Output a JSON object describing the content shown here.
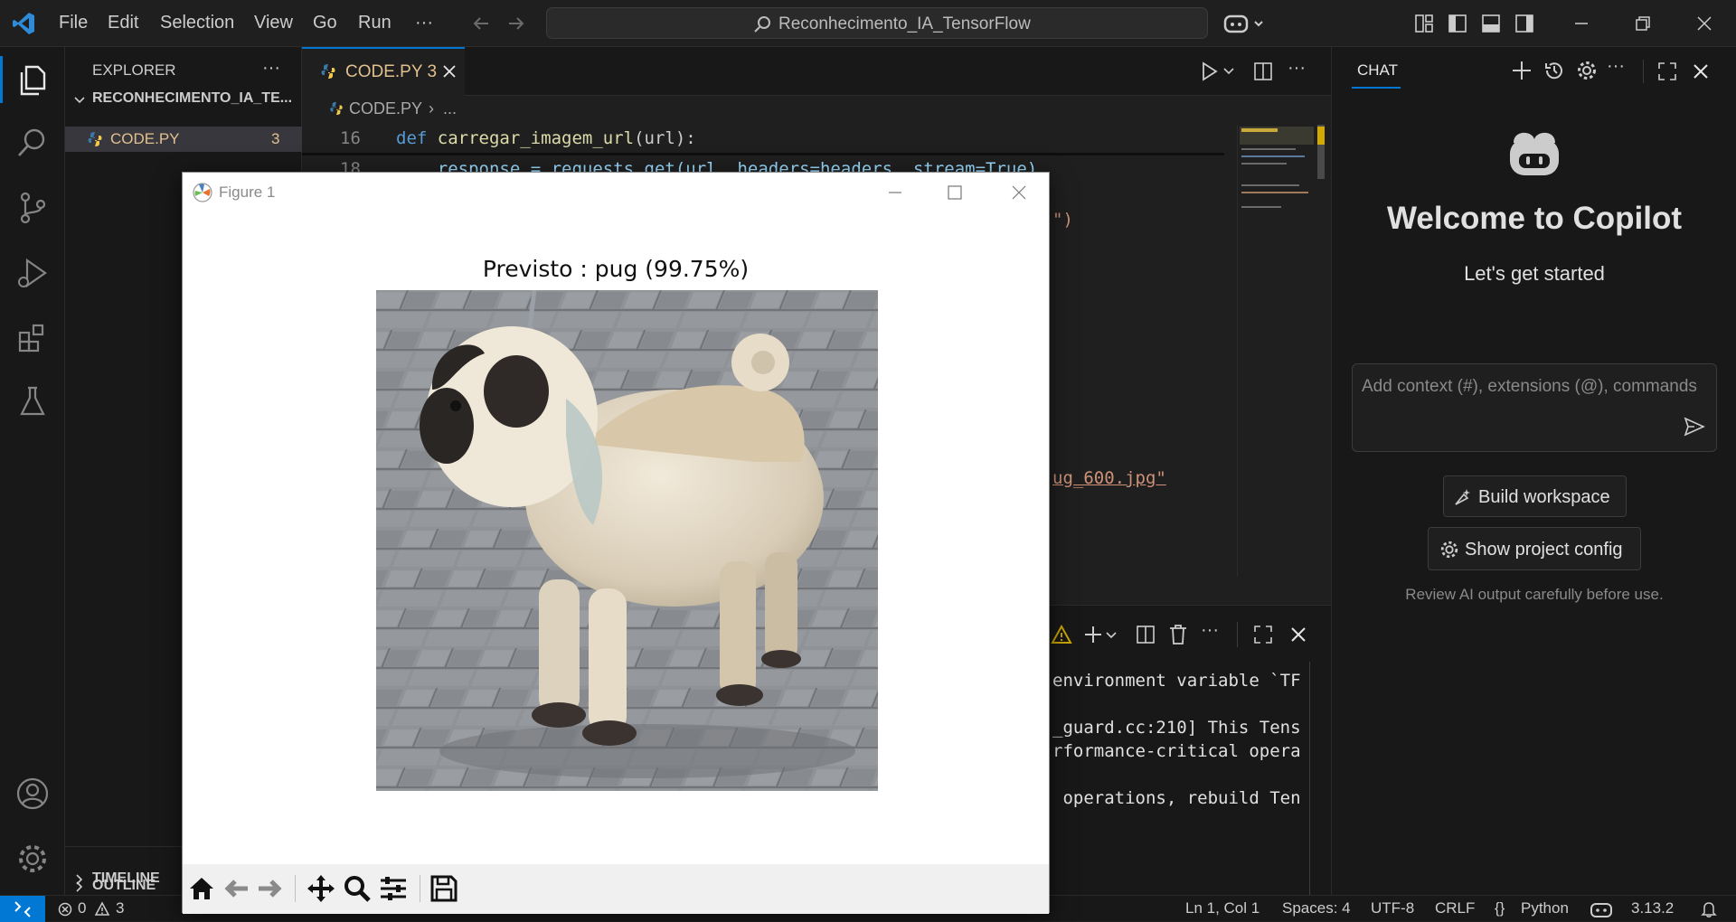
{
  "titlebar": {
    "menu": [
      "File",
      "Edit",
      "Selection",
      "View",
      "Go",
      "Run",
      "···"
    ],
    "search_text": "Reconhecimento_IA_TensorFlow"
  },
  "sidebar": {
    "title": "EXPLORER",
    "more": "···",
    "folder": "RECONHECIMENTO_IA_TE...",
    "file_name": "CODE.PY",
    "file_badge": "3",
    "outline": "OUTLINE",
    "timeline": "TIMELINE"
  },
  "editor": {
    "tab_label": "CODE.PY 3",
    "breadcrumb_file": "CODE.PY",
    "breadcrumb_rest": "...",
    "more": "···",
    "lines": [
      {
        "num": "16",
        "text_kw": "def ",
        "text_fn": "carregar_imagem_url",
        "text_rest": "(url):"
      },
      {
        "num": "18",
        "text": "    response = requests.get(url, headers=headers, stream=True)"
      }
    ],
    "fragment_paren": "\")",
    "fragment_url": "ug_600.jpg",
    "fragment_quote": "\""
  },
  "terminal": {
    "more": "···",
    "lines": [
      "environment variable `TF",
      "_guard.cc:210] This Tens",
      "rformance-critical opera",
      " operations, rebuild Ten"
    ]
  },
  "chat": {
    "tab": "CHAT",
    "more": "···",
    "welcome": "Welcome to Copilot",
    "subtitle": "Let's get started",
    "input_placeholder": "Add context (#), extensions (@), commands",
    "build_workspace": "Build workspace",
    "show_config": "Show project config",
    "disclaimer": "Review AI output carefully before use."
  },
  "figure": {
    "window_title": "Figure 1",
    "plot_title": "Previsto :  pug (99.75%)"
  },
  "statusbar": {
    "errors": "0",
    "warnings": "3",
    "position": "Ln 1, Col 1",
    "spaces": "Spaces: 4",
    "encoding": "UTF-8",
    "eol": "CRLF",
    "language_prefix": "{}",
    "language": "Python",
    "python_version": "3.13.2"
  },
  "colors": {
    "accent": "#0078d4",
    "keyword": "#569cd6",
    "function": "#dcdcaa",
    "string": "#ce9178",
    "tab_modified": "#e2c08d",
    "remote": "#0078d4"
  }
}
